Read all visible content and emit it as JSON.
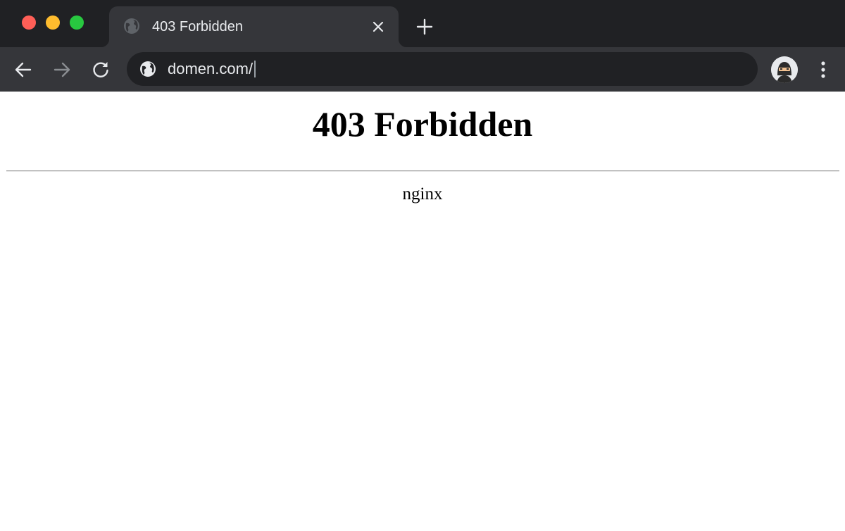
{
  "window": {
    "controls": [
      "close",
      "minimize",
      "zoom"
    ]
  },
  "tab": {
    "title": "403 Forbidden",
    "favicon": "globe-icon"
  },
  "toolbar": {
    "url": "domen.com/",
    "icons": [
      "back-arrow-icon",
      "forward-arrow-icon",
      "reload-icon",
      "globe-icon",
      "profile-avatar",
      "more-vertical-icon"
    ]
  },
  "page": {
    "heading": "403 Forbidden",
    "server": "nginx"
  },
  "colors": {
    "titlebar": "#202124",
    "toolbar": "#35363a",
    "omnibox": "#202124",
    "close": "#ff5f57",
    "minimize": "#febc2e",
    "zoom": "#28c840"
  }
}
